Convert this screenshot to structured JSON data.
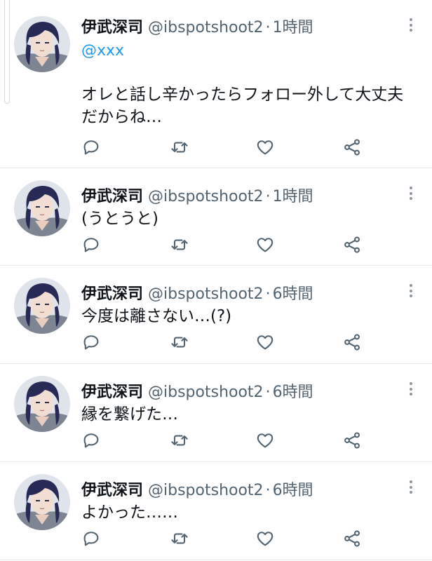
{
  "colors": {
    "text": "#0f1419",
    "secondary": "#536471",
    "link": "#1d9bf0",
    "divider": "#e6e9eb",
    "icon": "#536471"
  },
  "icons": {
    "reply": "reply-icon",
    "retweet": "retweet-icon",
    "like": "heart-icon",
    "share": "share-icon",
    "more": "more-vertical-icon"
  },
  "tweets": [
    {
      "name": "伊武深司",
      "handle": "@ibspotshoot2",
      "separator": "·",
      "time": "1時間",
      "mention": "@xxx",
      "text": "オレと話し辛かったらフォロー外して大丈夫だからね…"
    },
    {
      "name": "伊武深司",
      "handle": "@ibspotshoot2",
      "separator": "·",
      "time": "1時間",
      "text": "(うとうと)"
    },
    {
      "name": "伊武深司",
      "handle": "@ibspotshoot2",
      "separator": "·",
      "time": "6時間",
      "text": "今度は離さない…(?)"
    },
    {
      "name": "伊武深司",
      "handle": "@ibspotshoot2",
      "separator": "·",
      "time": "6時間",
      "text": "縁を繋げた…"
    },
    {
      "name": "伊武深司",
      "handle": "@ibspotshoot2",
      "separator": "·",
      "time": "6時間",
      "text": "よかった……"
    }
  ]
}
